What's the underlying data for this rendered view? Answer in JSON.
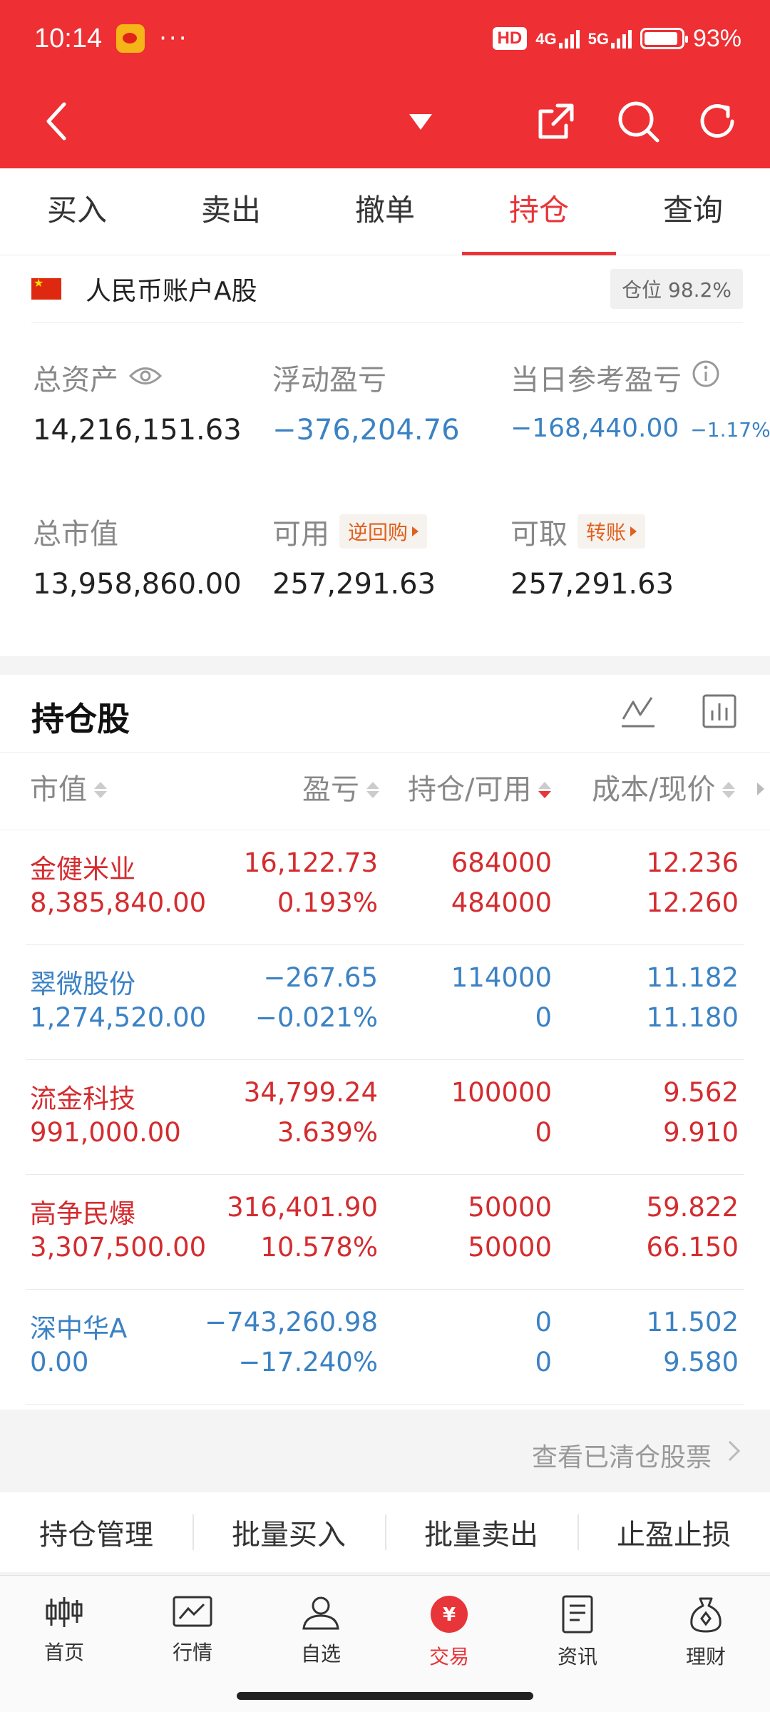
{
  "status": {
    "time": "10:14",
    "dots": "···",
    "hd": "HD",
    "net1": "4G",
    "net2": "5G",
    "battery": "93%"
  },
  "tabs": [
    "买入",
    "卖出",
    "撤单",
    "持仓",
    "查询"
  ],
  "account": {
    "name": "人民币账户A股",
    "position_label": "仓位 98.2%"
  },
  "stats": {
    "total_assets_label": "总资产",
    "total_assets": "14,216,151.63",
    "floating_pl_label": "浮动盈亏",
    "floating_pl": "−376,204.76",
    "daily_pl_label": "当日参考盈亏",
    "daily_pl": "−168,440.00",
    "daily_pl_pct": "−1.17%",
    "market_value_label": "总市值",
    "market_value": "13,958,860.00",
    "available_label": "可用",
    "available_chip": "逆回购",
    "available": "257,291.63",
    "withdrawable_label": "可取",
    "withdrawable_chip": "转账",
    "withdrawable": "257,291.63"
  },
  "holdings": {
    "title": "持仓股",
    "headers": {
      "value": "市值",
      "pl": "盈亏",
      "qty": "持仓/可用",
      "price": "成本/现价"
    },
    "rows": [
      {
        "name": "金健米业",
        "value": "8,385,840.00",
        "pl": "16,122.73",
        "pl_pct": "0.193%",
        "qty": "684000",
        "avail": "484000",
        "cost": "12.236",
        "price": "12.260",
        "color": "red"
      },
      {
        "name": "翠微股份",
        "value": "1,274,520.00",
        "pl": "−267.65",
        "pl_pct": "−0.021%",
        "qty": "114000",
        "avail": "0",
        "cost": "11.182",
        "price": "11.180",
        "color": "blue"
      },
      {
        "name": "流金科技",
        "value": "991,000.00",
        "pl": "34,799.24",
        "pl_pct": "3.639%",
        "qty": "100000",
        "avail": "0",
        "cost": "9.562",
        "price": "9.910",
        "color": "red"
      },
      {
        "name": "高争民爆",
        "value": "3,307,500.00",
        "pl": "316,401.90",
        "pl_pct": "10.578%",
        "qty": "50000",
        "avail": "50000",
        "cost": "59.822",
        "price": "66.150",
        "color": "red"
      },
      {
        "name": "深中华A",
        "value": "0.00",
        "pl": "−743,260.98",
        "pl_pct": "−17.240%",
        "qty": "0",
        "avail": "0",
        "cost": "11.502",
        "price": "9.580",
        "color": "blue"
      }
    ]
  },
  "cleared_link": "查看已清仓股票",
  "actions": [
    "持仓管理",
    "批量买入",
    "批量卖出",
    "止盈止损"
  ],
  "bottom_nav": [
    "首页",
    "行情",
    "自选",
    "交易",
    "资讯",
    "理财"
  ],
  "colors": {
    "brand": "#ee2f33",
    "up": "#d42c2f",
    "down": "#3b82c4"
  }
}
